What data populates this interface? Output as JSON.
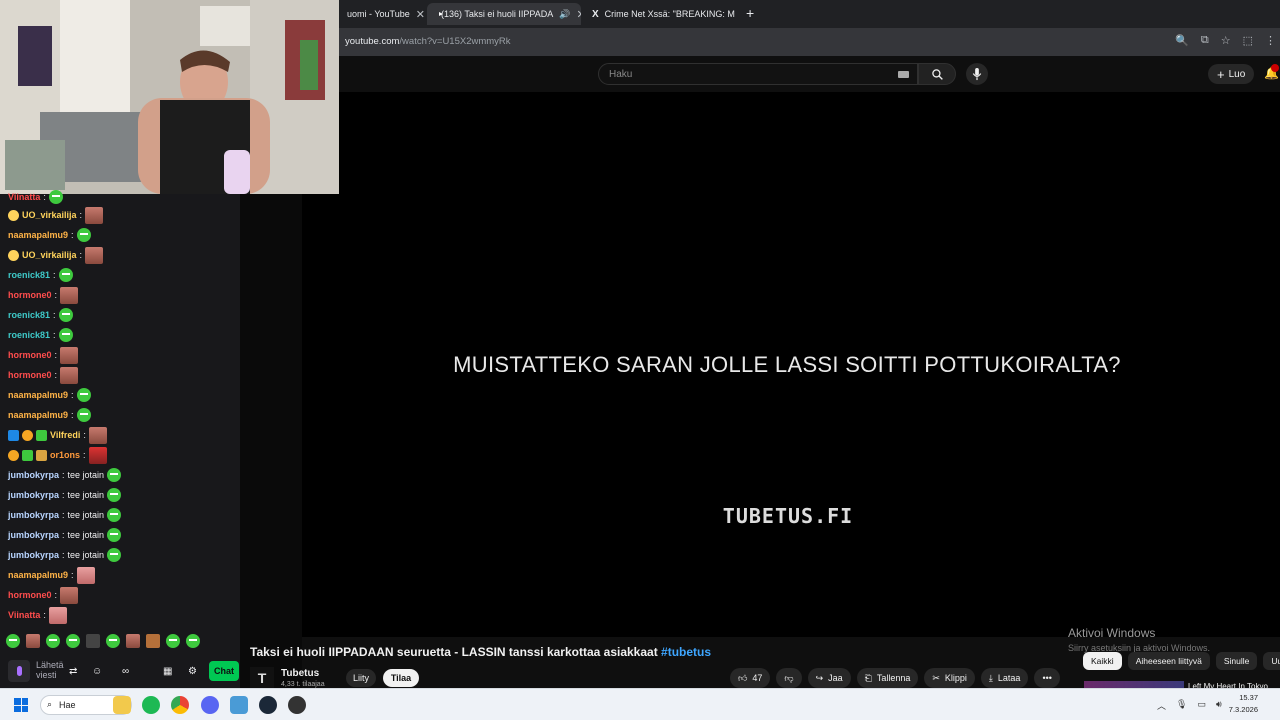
{
  "browser": {
    "tabs": [
      {
        "label": "uomi - YouTube",
        "active": false
      },
      {
        "label": "(136) Taksi ei huoli IIPPADA",
        "active": true
      },
      {
        "label": "Crime Net Xssä: \"BREAKING: M",
        "active": false
      }
    ],
    "url_host": "youtube.com",
    "url_path": "/watch?v=U15X2wmmyRk"
  },
  "youtube": {
    "search_placeholder": "Haku",
    "create_label": "Luo",
    "video": {
      "subtitle": "MUISTATTEKO SARAN JOLLE LASSI SOITTI POTTUKOIRALTA?",
      "brand": "TUBETUS.FI",
      "title": "Taksi ei huoli IIPPADAAN seuruetta - LASSIN tanssi karkottaa asiakkaat",
      "hashtag": "#tubetus"
    },
    "channel": {
      "name": "Tubetus",
      "subs": "4,33 t. tilaajaa",
      "logo": "T"
    },
    "join_label": "Liity",
    "subscribe_label": "Tilaa",
    "actions": {
      "likes": "47",
      "share": "Jaa",
      "save": "Tallenna",
      "clip": "Klippi",
      "download": "Lataa"
    },
    "chips": [
      "Kaikki",
      "Aiheeseen liittyvä",
      "Sinulle",
      "Uud"
    ],
    "recommended_title": "Left My Heart In Tokyo"
  },
  "windows_watermark": {
    "title": "Aktivoi Windows",
    "text": "Siirry asetuksiin ja aktivoi Windows."
  },
  "chat": {
    "messages": [
      {
        "user": "Viinatta",
        "color": "#ff4d4d",
        "text": "",
        "emote": "pepe"
      },
      {
        "user": "UO_virkailija",
        "color": "#ffd35c",
        "text": "",
        "emote": "face"
      },
      {
        "user": "naamapalmu9",
        "color": "#ffb347",
        "text": "",
        "emote": "pepe"
      },
      {
        "user": "UO_virkailija",
        "color": "#ffd35c",
        "text": "",
        "emote": "face"
      },
      {
        "user": "roenick81",
        "color": "#3ec9c9",
        "text": "",
        "emote": "pepe"
      },
      {
        "user": "hormone0",
        "color": "#ff4d4d",
        "text": "",
        "emote": "face"
      },
      {
        "user": "roenick81",
        "color": "#3ec9c9",
        "text": "",
        "emote": "pepe"
      },
      {
        "user": "roenick81",
        "color": "#3ec9c9",
        "text": "",
        "emote": "pepe"
      },
      {
        "user": "hormone0",
        "color": "#ff4d4d",
        "text": "",
        "emote": "face"
      },
      {
        "user": "hormone0",
        "color": "#ff4d4d",
        "text": "",
        "emote": "face"
      },
      {
        "user": "naamapalmu9",
        "color": "#ffb347",
        "text": "",
        "emote": "pepe"
      },
      {
        "user": "naamapalmu9",
        "color": "#ffb347",
        "text": "",
        "emote": "pepe"
      },
      {
        "user": "Vilfredi",
        "color": "#ffd35c",
        "text": "",
        "emote": "face"
      },
      {
        "user": "or1ons",
        "color": "#ff9a3c",
        "text": "",
        "emote": "face"
      },
      {
        "user": "jumbokyrpa",
        "color": "#b8d4ff",
        "text": "tee jotain",
        "emote": "pepe"
      },
      {
        "user": "jumbokyrpa",
        "color": "#b8d4ff",
        "text": "tee jotain",
        "emote": "pepe"
      },
      {
        "user": "jumbokyrpa",
        "color": "#b8d4ff",
        "text": "tee jotain",
        "emote": "pepe"
      },
      {
        "user": "jumbokyrpa",
        "color": "#b8d4ff",
        "text": "tee jotain",
        "emote": "pepe"
      },
      {
        "user": "jumbokyrpa",
        "color": "#b8d4ff",
        "text": "tee jotain",
        "emote": "pepe"
      },
      {
        "user": "naamapalmu9",
        "color": "#ffb347",
        "text": "",
        "emote": "face"
      },
      {
        "user": "hormone0",
        "color": "#ff4d4d",
        "text": "",
        "emote": "face"
      },
      {
        "user": "Viinatta",
        "color": "#ff4d4d",
        "text": "",
        "emote": "face"
      }
    ],
    "send_label_1": "Lähetä",
    "send_label_2": "viesti",
    "chat_button": "Chat"
  },
  "taskbar": {
    "search_label": "Hae",
    "time": "15.37",
    "date": "7.3.2026"
  }
}
